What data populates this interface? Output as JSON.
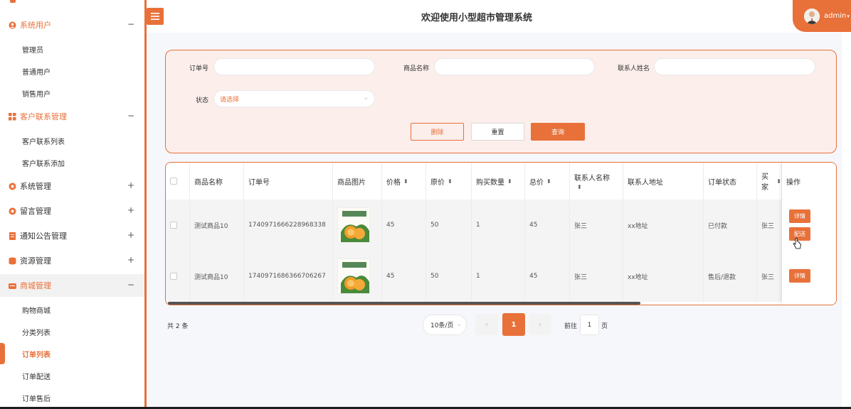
{
  "sidebar": {
    "groups": [
      {
        "label": "系统用户",
        "sign": "−"
      },
      {
        "label": "客户联系管理",
        "sign": "−"
      },
      {
        "label": "系统管理",
        "sign": "+"
      },
      {
        "label": "留言管理",
        "sign": "+"
      },
      {
        "label": "通知公告管理",
        "sign": "+"
      },
      {
        "label": "资源管理",
        "sign": "+"
      },
      {
        "label": "商城管理",
        "sign": "−"
      }
    ],
    "subitems": {
      "system_users": [
        "管理员",
        "普通用户",
        "销售用户"
      ],
      "customer_contact": [
        "客户联系列表",
        "客户联系添加"
      ],
      "mall": [
        "购物商城",
        "分类列表",
        "订单列表",
        "订单配送",
        "订单售后"
      ]
    }
  },
  "header": {
    "title": "欢迎使用小型超市管理系统",
    "user": "admin"
  },
  "search": {
    "order_no_label": "订单号",
    "product_name_label": "商品名称",
    "contact_name_label": "联系人姓名",
    "status_label": "状态",
    "status_placeholder": "请选择",
    "delete_label": "删除",
    "reset_label": "重置",
    "query_label": "查询"
  },
  "table": {
    "columns": [
      "商品名称",
      "订单号",
      "商品图片",
      "价格",
      "原价",
      "购买数量",
      "总价",
      "联系人名称",
      "联系人地址",
      "订单状态",
      "买家",
      "操作"
    ],
    "rows": [
      {
        "product": "测试商品10",
        "order_no": "1740971666228968338",
        "price": "45",
        "original": "50",
        "qty": "1",
        "total": "45",
        "contact": "张三",
        "address": "xx地址",
        "status": "已付款",
        "buyer": "张三",
        "actions": [
          "详情",
          "配送"
        ]
      },
      {
        "product": "测试商品10",
        "order_no": "1740971686366706267",
        "price": "45",
        "original": "50",
        "qty": "1",
        "total": "45",
        "contact": "张三",
        "address": "xx地址",
        "status": "售后/退款",
        "buyer": "张三",
        "actions": [
          "详情"
        ]
      }
    ]
  },
  "pagination": {
    "total": "共 2 条",
    "page_size": "10条/页",
    "current_page": "1",
    "goto_label": "前往",
    "goto_value": "1",
    "goto_suffix": "页"
  },
  "colors": {
    "accent": "#e8713a"
  }
}
